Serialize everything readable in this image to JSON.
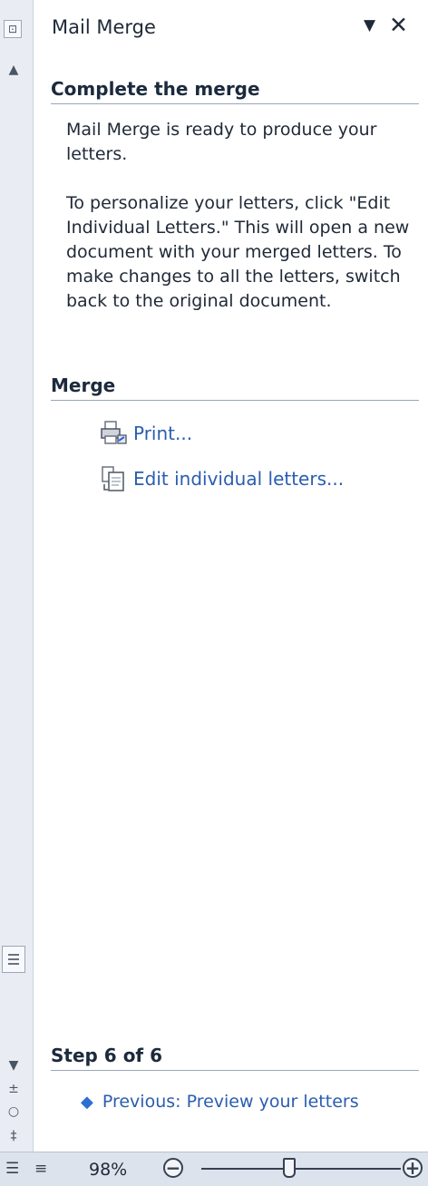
{
  "pane": {
    "title": "Mail Merge",
    "dropdown_glyph": "▼",
    "close_glyph": "✕"
  },
  "complete": {
    "heading": "Complete the merge",
    "para1": "Mail Merge is ready to produce your letters.",
    "para2": "To personalize your letters, click \"Edit Individual Letters.\" This will open a new document with your merged letters. To make changes to all the letters, switch back to the original document."
  },
  "merge": {
    "heading": "Merge",
    "print_label": "Print...",
    "edit_label": "Edit individual letters..."
  },
  "step": {
    "heading": "Step 6 of 6",
    "previous_label": "Previous: Preview your letters"
  },
  "statusbar": {
    "zoom_label": "98%",
    "zoom_out": "−",
    "zoom_in": "+"
  },
  "icons": {
    "dropdown": "chevron-down-icon",
    "close": "close-icon",
    "print": "printer-icon",
    "edit": "document-icon",
    "previous": "back-arrow-icon"
  }
}
